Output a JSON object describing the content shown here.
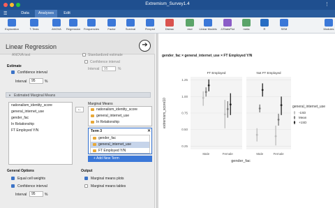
{
  "window": {
    "title": "Extremism_Survey1.4"
  },
  "tabs": [
    "Data",
    "Analyses",
    "Edit"
  ],
  "ribbon": [
    {
      "label": "Exploration",
      "icon": "exploration-icon",
      "color": "#3b78d8"
    },
    {
      "label": "T-Tests",
      "icon": "ttests-icon",
      "color": "#3b78d8"
    },
    {
      "label": "ANOVA",
      "icon": "anova-icon",
      "color": "#3b78d8"
    },
    {
      "label": "Regression",
      "icon": "regression-icon",
      "color": "#3b78d8"
    },
    {
      "label": "Frequencies",
      "icon": "frequencies-icon",
      "color": "#3b78d8"
    },
    {
      "label": "Factor",
      "icon": "factor-icon",
      "color": "#3b78d8"
    },
    {
      "label": "Survival",
      "icon": "survival-icon",
      "color": "#3b78d8"
    },
    {
      "label": "Flexplot",
      "icon": "flexplot-icon",
      "color": "#3b78d8"
    },
    {
      "label": "Distrac",
      "icon": "distrac-icon",
      "color": "#d9534f"
    },
    {
      "label": "esci",
      "icon": "esci-icon",
      "color": "#5aa469"
    },
    {
      "label": "Linear Models",
      "icon": "linear-models-icon",
      "color": "#3b78d8"
    },
    {
      "label": "JJStatsPlot",
      "icon": "jjstatsplot-icon",
      "color": "#8a5cc7"
    },
    {
      "label": "meta",
      "icon": "meta-icon",
      "color": "#5aa469"
    },
    {
      "label": "R",
      "icon": "r-icon",
      "color": "#276dc3"
    },
    {
      "label": "SEM",
      "icon": "sem-icon",
      "color": "#3b78d8"
    },
    {
      "label": "Modules",
      "icon": "modules-icon",
      "color": "#3b78d8"
    }
  ],
  "analysis": {
    "title": "Linear Regression",
    "top_cut": {
      "anova_test": "ANOVA test",
      "standardized": "Standardized estimate",
      "conf_interval_disabled": "Confidence interval",
      "interval_disabled_label": "Interval",
      "interval_disabled_value": "95",
      "pct": "%"
    },
    "estimate": {
      "heading": "Estimate",
      "conf_interval": "Confidence interval",
      "interval_label": "Interval",
      "interval_value": "95",
      "pct": "%"
    },
    "emm_section": "Estimated Marginal Means",
    "variables": [
      "nationalism_identity_score",
      "general_internet_use",
      "gender_fac",
      "In Relationship",
      "FT Employed Y/N"
    ],
    "marginal_means": {
      "heading": "Marginal Means",
      "items": [
        "nationalism_identity_score",
        "general_internet_use",
        "In Relationship"
      ]
    },
    "term3": {
      "heading": "Term 3",
      "items": [
        "gender_fac",
        "general_internet_use",
        "FT Employed Y/N"
      ],
      "add_term": "+ Add New Term"
    },
    "general_options": {
      "heading": "General Options",
      "equal_cell_weights": "Equal cell weights",
      "conf_interval": "Confidence interval",
      "interval_label": "Interval",
      "interval_value": "95",
      "pct": "%"
    },
    "output": {
      "heading": "Output",
      "means_plots": "Marginal means plots",
      "means_tables": "Marginal means tables"
    }
  },
  "results": {
    "plot_title": "gender_fac × general_internet_use × FT Employed Y/N"
  },
  "chart_data": {
    "type": "scatter",
    "panels": [
      "FT Employed",
      "Not FT Employed"
    ],
    "categories": [
      "Male",
      "Female"
    ],
    "xlabel": "gender_fac",
    "ylabel": "extremism_score10",
    "yticks": [
      "1.25",
      "1.00",
      "0.75",
      "0.50",
      "0.25"
    ],
    "ylim": [
      0.2,
      1.3
    ],
    "grid": true,
    "legend": {
      "title": "general_internet_use",
      "entries": [
        "-1SD",
        "Mean",
        "+1SD"
      ],
      "placement": "right"
    },
    "series": [
      {
        "name": "-1SD",
        "color": "#bbbbbb",
        "FT Employed": [
          0.98,
          0.73
        ],
        "Not FT Employed": [
          0.42,
          0.4
        ],
        "ci_FT Employed": [
          [
            0.86,
            1.08
          ],
          [
            0.52,
            0.95
          ]
        ],
        "ci_Not FT Employed": [
          [
            0.32,
            0.52
          ],
          [
            0.26,
            0.56
          ]
        ]
      },
      {
        "name": "Mean",
        "color": "#777777",
        "FT Employed": [
          1.07,
          0.81
        ],
        "Not FT Employed": [
          0.82,
          0.65
        ],
        "ci_FT Employed": [
          [
            1.0,
            1.14
          ],
          [
            0.68,
            0.93
          ]
        ],
        "ci_Not FT Employed": [
          [
            0.76,
            0.88
          ],
          [
            0.56,
            0.74
          ]
        ]
      },
      {
        "name": "+1SD",
        "color": "#222222",
        "FT Employed": [
          1.17,
          0.88
        ],
        "Not FT Employed": [
          1.1,
          0.87
        ],
        "ci_FT Employed": [
          [
            1.08,
            1.26
          ],
          [
            0.72,
            1.05
          ]
        ],
        "ci_Not FT Employed": [
          [
            1.0,
            1.2
          ],
          [
            0.72,
            1.0
          ]
        ]
      }
    ]
  }
}
